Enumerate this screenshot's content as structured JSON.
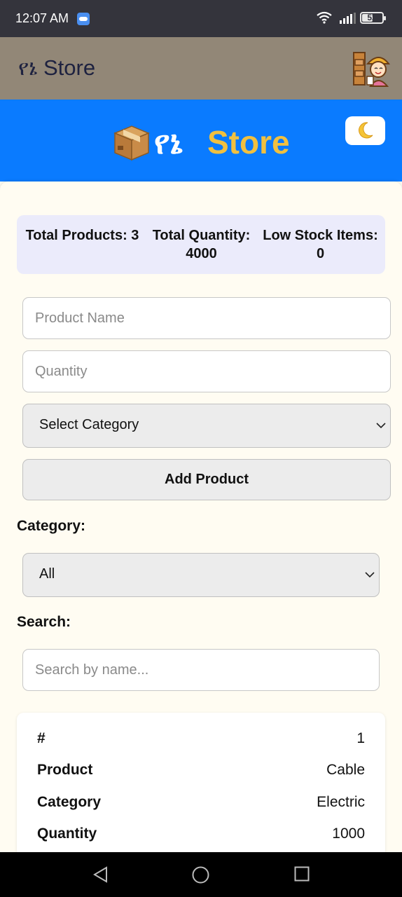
{
  "status_bar": {
    "time": "12:07 AM",
    "battery": "52"
  },
  "app_bar": {
    "title": "የኔ Store"
  },
  "header": {
    "title_amharic": "የኔ",
    "title_store": "Store",
    "theme_toggle_icon": "moon-icon"
  },
  "stats": {
    "total_products": "Total Products: 3",
    "total_quantity": "Total Quantity: 4000",
    "low_stock": "Low Stock Items: 0"
  },
  "form": {
    "product_name_placeholder": "Product Name",
    "quantity_placeholder": "Quantity",
    "category_select": "Select Category",
    "add_button": "Add Product"
  },
  "filters": {
    "category_label": "Category:",
    "category_value": "All",
    "search_label": "Search:",
    "search_placeholder": "Search by name..."
  },
  "product": {
    "rows": [
      {
        "key": "#",
        "value": "1"
      },
      {
        "key": "Product",
        "value": "Cable"
      },
      {
        "key": "Category",
        "value": "Electric"
      },
      {
        "key": "Quantity",
        "value": "1000"
      }
    ]
  },
  "colors": {
    "app_bar": "#928777",
    "header": "#0a7bff",
    "accent": "#f0c040",
    "stats_bg": "#ebebfb"
  }
}
